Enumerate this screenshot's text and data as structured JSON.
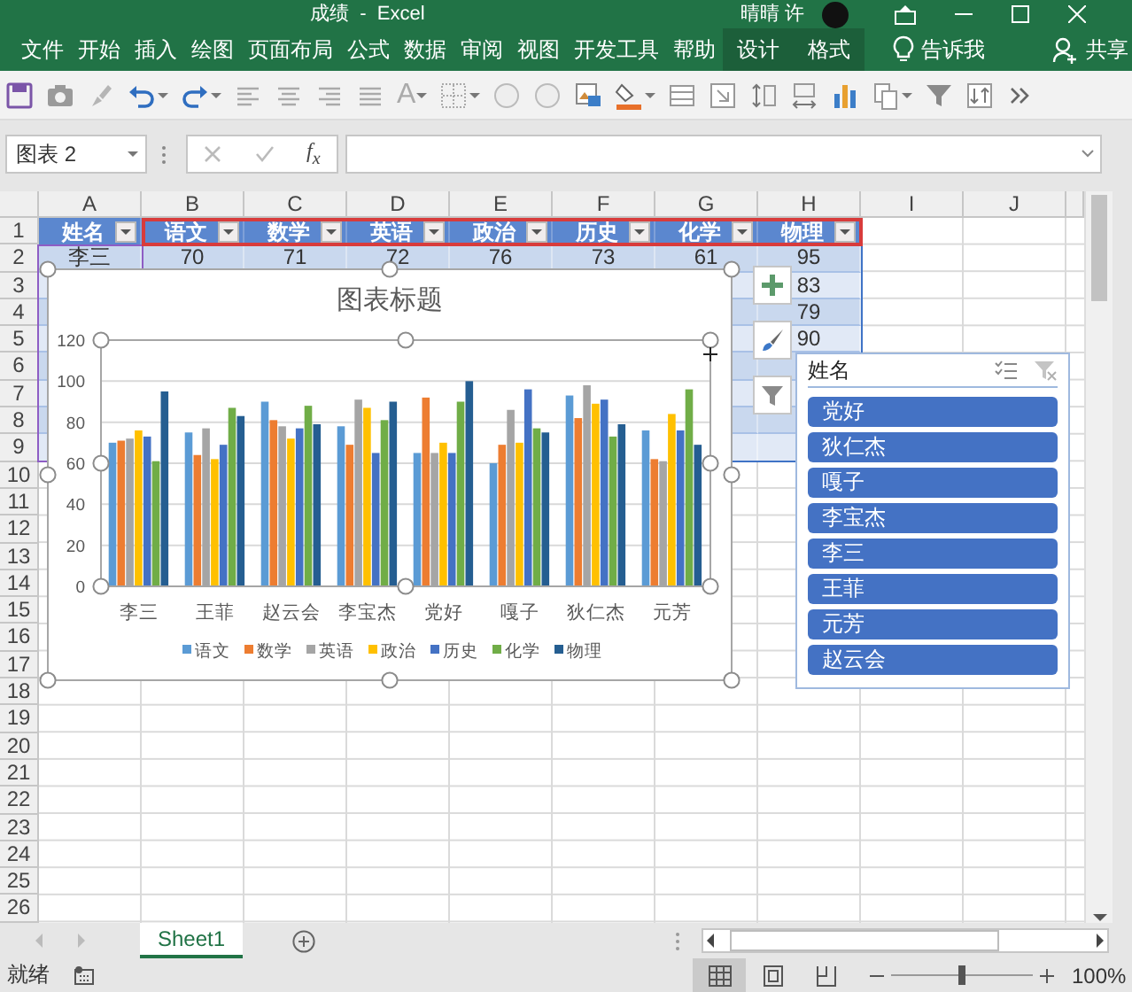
{
  "window": {
    "title": "成绩  -  Excel",
    "user": "晴晴 许"
  },
  "ribbon_tabs": [
    {
      "label": "文件",
      "kind": "normal"
    },
    {
      "label": "开始",
      "kind": "normal"
    },
    {
      "label": "插入",
      "kind": "normal"
    },
    {
      "label": "绘图",
      "kind": "normal"
    },
    {
      "label": "页面布局",
      "kind": "normal"
    },
    {
      "label": "公式",
      "kind": "normal"
    },
    {
      "label": "数据",
      "kind": "normal"
    },
    {
      "label": "审阅",
      "kind": "normal"
    },
    {
      "label": "视图",
      "kind": "normal"
    },
    {
      "label": "开发工具",
      "kind": "normal"
    },
    {
      "label": "帮助",
      "kind": "normal"
    },
    {
      "label": "设计",
      "kind": "contextual"
    },
    {
      "label": "格式",
      "kind": "contextual"
    }
  ],
  "tell_me": "告诉我",
  "share": "共享",
  "toolbar": {
    "font_glyph": "A"
  },
  "formula_bar": {
    "name_box": "图表 2",
    "function_label": "f$_{x}$"
  },
  "column_headers": [
    "A",
    "B",
    "C",
    "D",
    "E",
    "F",
    "G",
    "H",
    "I",
    "J"
  ],
  "row_headers": [
    "1",
    "2",
    "3",
    "4",
    "5",
    "6",
    "7",
    "8",
    "9",
    "10",
    "11",
    "12",
    "13",
    "14",
    "15",
    "16",
    "17",
    "18",
    "19",
    "20",
    "21",
    "22",
    "23",
    "24",
    "25",
    "26"
  ],
  "table": {
    "columns": [
      "姓名",
      "语文",
      "数学",
      "英语",
      "政治",
      "历史",
      "化学",
      "物理"
    ],
    "rows": [
      [
        "李三",
        "70",
        "71",
        "72",
        "76",
        "73",
        "61",
        "95"
      ]
    ],
    "column_h_more": [
      "83",
      "79",
      "90"
    ]
  },
  "chart": {
    "chart_data": {
      "type": "bar",
      "title": "图表标题",
      "categories": [
        "李三",
        "王菲",
        "赵云会",
        "李宝杰",
        "党好",
        "嘎子",
        "狄仁杰",
        "元芳"
      ],
      "ylim": [
        0,
        120
      ],
      "grid": true,
      "legend": "bottom",
      "yticks": [
        0,
        20,
        40,
        60,
        80,
        100,
        120
      ],
      "series": [
        {
          "name": "语文",
          "color": "#5b9bd5",
          "values": [
            70,
            75,
            90,
            78,
            65,
            60,
            93,
            76
          ]
        },
        {
          "name": "数学",
          "color": "#ed7d31",
          "values": [
            71,
            64,
            81,
            69,
            92,
            69,
            82,
            62
          ]
        },
        {
          "name": "英语",
          "color": "#a5a5a5",
          "values": [
            72,
            77,
            78,
            91,
            65,
            86,
            98,
            61
          ]
        },
        {
          "name": "政治",
          "color": "#ffc000",
          "values": [
            76,
            62,
            72,
            87,
            70,
            70,
            89,
            84
          ]
        },
        {
          "name": "历史",
          "color": "#4472c4",
          "values": [
            73,
            69,
            77,
            65,
            65,
            96,
            91,
            76
          ]
        },
        {
          "name": "化学",
          "color": "#70ad47",
          "values": [
            61,
            87,
            88,
            81,
            90,
            77,
            73,
            96
          ]
        },
        {
          "name": "物理",
          "color": "#255e91",
          "values": [
            95,
            83,
            79,
            90,
            100,
            75,
            79,
            69
          ]
        }
      ]
    }
  },
  "slicer": {
    "title": "姓名",
    "items": [
      {
        "label": "党好",
        "selected": true
      },
      {
        "label": "狄仁杰",
        "selected": true
      },
      {
        "label": "嘎子",
        "selected": true
      },
      {
        "label": "李宝杰",
        "selected": true
      },
      {
        "label": "李三",
        "selected": true
      },
      {
        "label": "王菲",
        "selected": true
      },
      {
        "label": "元芳",
        "selected": true
      },
      {
        "label": "赵云会",
        "selected": true
      }
    ]
  },
  "sheets": [
    {
      "label": "Sheet1",
      "selected": true
    }
  ],
  "status_bar": {
    "status": "就绪",
    "views": [
      {
        "kind": "normal",
        "selected": true
      },
      {
        "kind": "page_layout",
        "selected": false
      },
      {
        "kind": "page_break",
        "selected": false
      }
    ],
    "zoom": {
      "level": 0.5,
      "reading": "100%"
    }
  }
}
